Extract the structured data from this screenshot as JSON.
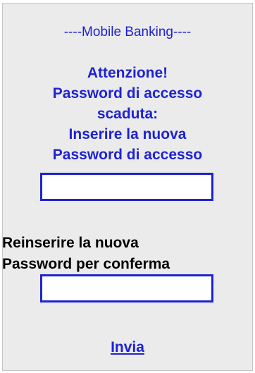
{
  "header": {
    "title": "----Mobile Banking----"
  },
  "warning": {
    "line1": "Attenzione!",
    "line2": "Password di accesso",
    "line3": "scaduta:",
    "line4": "Inserire la nuova",
    "line5": "Password di accesso"
  },
  "new_password": {
    "value": "",
    "placeholder": ""
  },
  "confirm": {
    "line1": "Reinserire la nuova",
    "line2": "Password per conferma",
    "value": "",
    "placeholder": ""
  },
  "submit": {
    "label": "Invia"
  },
  "colors": {
    "text": "#1e22d4",
    "panel_background": "#ebebeb",
    "panel_border": "#c4c4c4"
  }
}
